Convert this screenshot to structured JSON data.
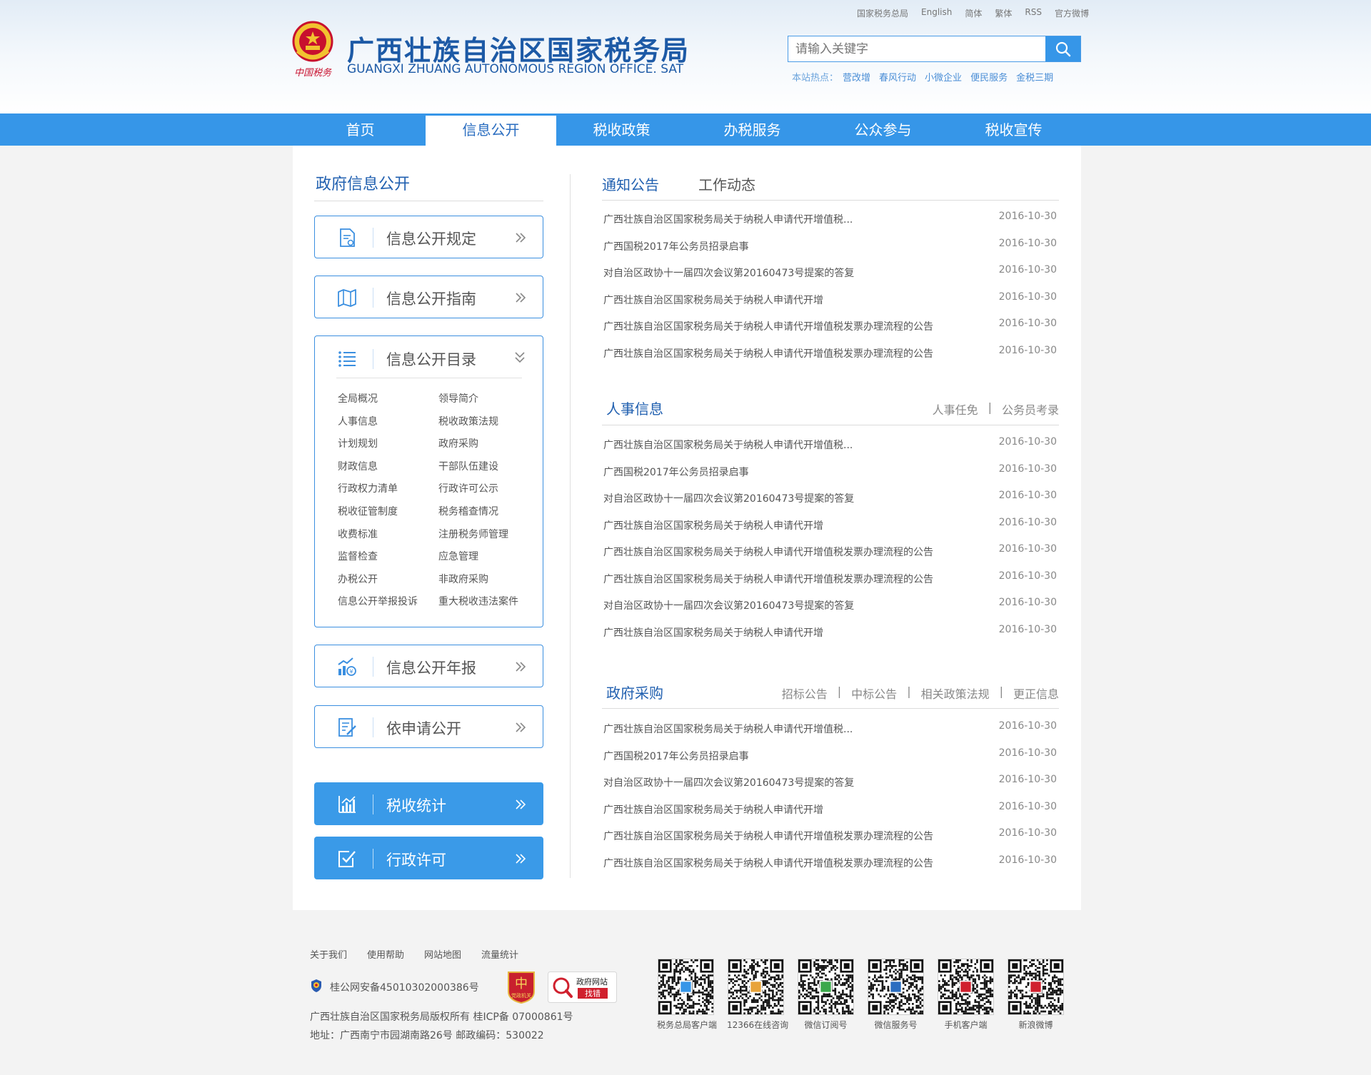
{
  "header": {
    "title_cn": "广西壮族自治区国家税务局",
    "title_en": "GUANGXI ZHUANG AUTONOMOUS REGION OFFICE. SAT",
    "emblem_caption": "中国税务",
    "top_links": [
      "国家税务总局",
      "English",
      "简体",
      "繁体",
      "RSS",
      "官方微博"
    ],
    "search_placeholder": "请输入关键字",
    "hot_label": "本站热点：",
    "hot_words": [
      "营改增",
      "春风行动",
      "小微企业",
      "便民服务",
      "金税三期"
    ]
  },
  "nav": {
    "items": [
      "首页",
      "信息公开",
      "税收政策",
      "办税服务",
      "公众参与",
      "税收宣传"
    ],
    "active_index": 1
  },
  "sidebar": {
    "title": "政府信息公开",
    "btn_rules": "信息公开规定",
    "btn_guide": "信息公开指南",
    "catalog": {
      "label": "信息公开目录",
      "items": [
        "全局概况",
        "领导简介",
        "人事信息",
        "税收政策法规",
        "计划规划",
        "政府采购",
        "财政信息",
        "干部队伍建设",
        "行政权力清单",
        "行政许可公示",
        "税收征管制度",
        "税务稽查情况",
        "收费标准",
        "注册税务师管理",
        "监督检查",
        "应急管理",
        "办税公开",
        "非政府采购",
        "信息公开举报投诉",
        "重大税收违法案件"
      ]
    },
    "btn_annual": "信息公开年报",
    "btn_apply": "依申请公开",
    "btn_stats": "税收统计",
    "btn_permit": "行政许可"
  },
  "news": {
    "tab_notice": "通知公告",
    "tab_work": "工作动态",
    "notices": [
      {
        "title": "广西壮族自治区国家税务局关于纳税人申请代开增值税...",
        "date": "2016-10-30"
      },
      {
        "title": "广西国税2017年公务员招录启事",
        "date": "2016-10-30"
      },
      {
        "title": "对自治区政协十一届四次会议第20160473号提案的答复",
        "date": "2016-10-30"
      },
      {
        "title": "广西壮族自治区国家税务局关于纳税人申请代开增",
        "date": "2016-10-30"
      },
      {
        "title": "广西壮族自治区国家税务局关于纳税人申请代开增值税发票办理流程的公告",
        "date": "2016-10-30"
      },
      {
        "title": "广西壮族自治区国家税务局关于纳税人申请代开增值税发票办理流程的公告",
        "date": "2016-10-30"
      }
    ],
    "personnel": {
      "title": "人事信息",
      "links": [
        "人事任免",
        "公务员考录"
      ],
      "separator": "|",
      "items": [
        {
          "title": "广西壮族自治区国家税务局关于纳税人申请代开增值税...",
          "date": "2016-10-30"
        },
        {
          "title": "广西国税2017年公务员招录启事",
          "date": "2016-10-30"
        },
        {
          "title": "对自治区政协十一届四次会议第20160473号提案的答复",
          "date": "2016-10-30"
        },
        {
          "title": "广西壮族自治区国家税务局关于纳税人申请代开增",
          "date": "2016-10-30"
        },
        {
          "title": "广西壮族自治区国家税务局关于纳税人申请代开增值税发票办理流程的公告",
          "date": "2016-10-30"
        },
        {
          "title": "广西壮族自治区国家税务局关于纳税人申请代开增值税发票办理流程的公告",
          "date": "2016-10-30"
        },
        {
          "title": "对自治区政协十一届四次会议第20160473号提案的答复",
          "date": "2016-10-30"
        },
        {
          "title": "广西壮族自治区国家税务局关于纳税人申请代开增",
          "date": "2016-10-30"
        }
      ]
    },
    "procurement": {
      "title": "政府采购",
      "links": [
        "招标公告",
        "中标公告",
        "相关政策法规",
        "更正信息"
      ],
      "separator": "|",
      "items": [
        {
          "title": "广西壮族自治区国家税务局关于纳税人申请代开增值税...",
          "date": "2016-10-30"
        },
        {
          "title": "广西国税2017年公务员招录启事",
          "date": "2016-10-30"
        },
        {
          "title": "对自治区政协十一届四次会议第20160473号提案的答复",
          "date": "2016-10-30"
        },
        {
          "title": "广西壮族自治区国家税务局关于纳税人申请代开增",
          "date": "2016-10-30"
        },
        {
          "title": "广西壮族自治区国家税务局关于纳税人申请代开增值税发票办理流程的公告",
          "date": "2016-10-30"
        },
        {
          "title": "广西壮族自治区国家税务局关于纳税人申请代开增值税发票办理流程的公告",
          "date": "2016-10-30"
        }
      ]
    }
  },
  "footer": {
    "links": [
      "关于我们",
      "使用帮助",
      "网站地图",
      "流量统计"
    ],
    "police_record": "桂公网安备45010302000386号",
    "badge_party_text": "党政机关",
    "badge_error_line1": "政府网站",
    "badge_error_line2": "找错",
    "copyright": "广西壮族自治区国家税务局版权所有 桂ICP备 07000861号",
    "address": "地址：广西南宁市园湖南路26号 邮政编码：530022",
    "qr_codes": [
      "税务总局客户端",
      "12366在线咨询",
      "微信订阅号",
      "微信服务号",
      "手机客户端",
      "新浪微博"
    ]
  },
  "colors": {
    "brand_blue": "#3696e8",
    "title_blue": "#1d5aa6",
    "text_gray": "#555555"
  },
  "icons": [
    "emblem-icon",
    "search-icon",
    "document-icon",
    "map-icon",
    "list-icon",
    "chart-icon",
    "edit-icon",
    "stats-icon",
    "checkbox-icon",
    "chevron-double-right-icon",
    "chevron-double-down-icon",
    "police-badge-icon",
    "qr-code-icon"
  ]
}
